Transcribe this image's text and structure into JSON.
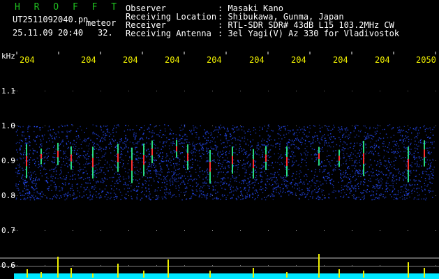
{
  "header": {
    "brand": "H R O F F T",
    "filename": "UT2511092040.pn",
    "mode": "meteor",
    "datetime": "25.11.09 20:40",
    "count": "32."
  },
  "info": [
    {
      "key": "Observer",
      "value": ": Masaki Kano"
    },
    {
      "key": "Receiving Location",
      "value": ": Shibukawa, Gunma, Japan"
    },
    {
      "key": "Receiver",
      "value": ": RTL-SDR SDR# 43dB L15 103.2MHz CW"
    },
    {
      "key": "Receiving Antenna",
      "value": ": 3el Yagi(V) Az 330 for Vladivostok"
    }
  ],
  "axis": {
    "y_unit": "kHz",
    "y_ticks": [
      "1.1",
      "1.0",
      "0.9",
      "0.8",
      "0.7",
      "0.6"
    ],
    "x_ticks": [
      "204",
      "204",
      "204",
      "204",
      "204",
      "204",
      "204",
      "204",
      "204",
      "2050"
    ]
  },
  "colors": {
    "background": "#000000",
    "noise": "#1a2fd0",
    "echo_core": "#ff3030",
    "echo_mid": "#30ff90",
    "baseline": "#00e8ff",
    "peaks": "#f0f000",
    "grid": "#ffffff"
  }
}
